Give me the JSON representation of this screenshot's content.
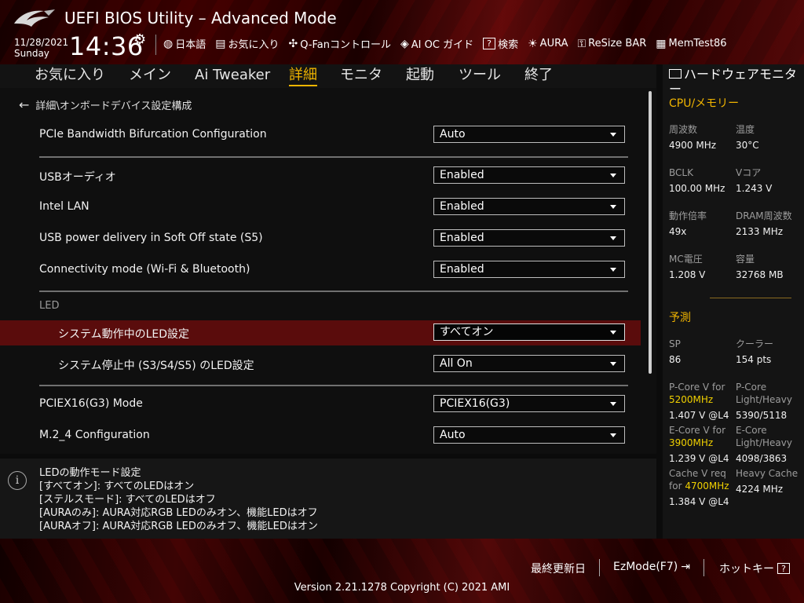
{
  "header": {
    "title": "UEFI BIOS Utility – Advanced Mode",
    "date": "11/28/2021",
    "day": "Sunday",
    "time": "14:36",
    "tools": [
      {
        "icon": "globe-icon",
        "label": "日本語"
      },
      {
        "icon": "favorites-icon",
        "label": "お気に入り"
      },
      {
        "icon": "fan-icon",
        "label": "Q-Fanコントロール"
      },
      {
        "icon": "ai-oc-icon",
        "label": "AI OC ガイド"
      },
      {
        "icon": "help-search-icon",
        "label": "検索"
      },
      {
        "icon": "aura-icon",
        "label": "AURA"
      },
      {
        "icon": "resize-bar-icon",
        "label": "ReSize BAR"
      },
      {
        "icon": "memtest-icon",
        "label": "MemTest86"
      }
    ]
  },
  "nav": {
    "tabs": [
      "お気に入り",
      "メイン",
      "Ai Tweaker",
      "詳細",
      "モニタ",
      "起動",
      "ツール",
      "終了"
    ],
    "active": "詳細"
  },
  "main": {
    "breadcrumb": "詳細\\オンボードデバイス設定構成",
    "section_led": "LED",
    "settings": [
      {
        "label": "PCIe Bandwidth Bifurcation Configuration",
        "value": "Auto"
      },
      {
        "label": "USBオーディオ",
        "value": "Enabled"
      },
      {
        "label": "Intel LAN",
        "value": "Enabled"
      },
      {
        "label": "USB power delivery in Soft Off state (S5)",
        "value": "Enabled"
      },
      {
        "label": "Connectivity mode (Wi-Fi & Bluetooth)",
        "value": "Enabled"
      },
      {
        "label": "システム動作中のLED設定",
        "value": "すべてオン"
      },
      {
        "label": "システム停止中 (S3/S4/S5) のLED設定",
        "value": "All On"
      },
      {
        "label": "PCIEX16(G3) Mode",
        "value": "PCIEX16(G3)"
      },
      {
        "label": "M.2_4 Configuration",
        "value": "Auto"
      }
    ]
  },
  "help": {
    "lines": [
      "LEDの動作モード設定",
      "[すべてオン]: すべてのLEDはオン",
      "[ステルスモード]: すべてのLEDはオフ",
      "[AURAのみ]: AURA対応RGB LEDのみオン、機能LEDはオフ",
      "[AURAオフ]: AURA対応RGB LEDのみオフ、機能LEDはオン"
    ]
  },
  "hw_monitor": {
    "title": "ハードウェアモニター",
    "cpu_section": "CPU/メモリー",
    "cpu": [
      {
        "label": "周波数",
        "value": "4900 MHz"
      },
      {
        "label": "温度",
        "value": "30°C"
      },
      {
        "label": "BCLK",
        "value": "100.00 MHz"
      },
      {
        "label": "Vコア",
        "value": "1.243 V"
      },
      {
        "label": "動作倍率",
        "value": "49x"
      },
      {
        "label": "DRAM周波数",
        "value": "2133 MHz"
      },
      {
        "label": "MC電圧",
        "value": "1.208 V"
      },
      {
        "label": "容量",
        "value": "32768 MB"
      }
    ],
    "predict_section": "予測",
    "sp_label": "SP",
    "sp_value": "86",
    "cooler_label": "クーラー",
    "cooler_value": "154 pts",
    "pcore_v_label": "P-Core V for",
    "pcore_v_freq": "5200MHz",
    "pcore_v_value": "1.407 V @L4",
    "pcore_lh_label1": "P-Core",
    "pcore_lh_label2": "Light/Heavy",
    "pcore_lh_value": "5390/5118",
    "ecore_v_label": "E-Core V for",
    "ecore_v_freq": "3900MHz",
    "ecore_v_value": "1.239 V @L4",
    "ecore_lh_label1": "E-Core",
    "ecore_lh_label2": "Light/Heavy",
    "ecore_lh_value": "4098/3863",
    "cache_v_label1": "Cache V req",
    "cache_v_label2": "for",
    "cache_v_freq": "4700MHz",
    "cache_v_value": "1.384 V @L4",
    "heavy_cache_label": "Heavy Cache",
    "heavy_cache_value": "4224 MHz"
  },
  "footer": {
    "last_modified": "最終更新日",
    "ezmode": "EzMode(F7)",
    "hotkey": "ホットキー",
    "hotkey_key": "?",
    "version": "Version 2.21.1278 Copyright (C) 2021 AMI"
  }
}
